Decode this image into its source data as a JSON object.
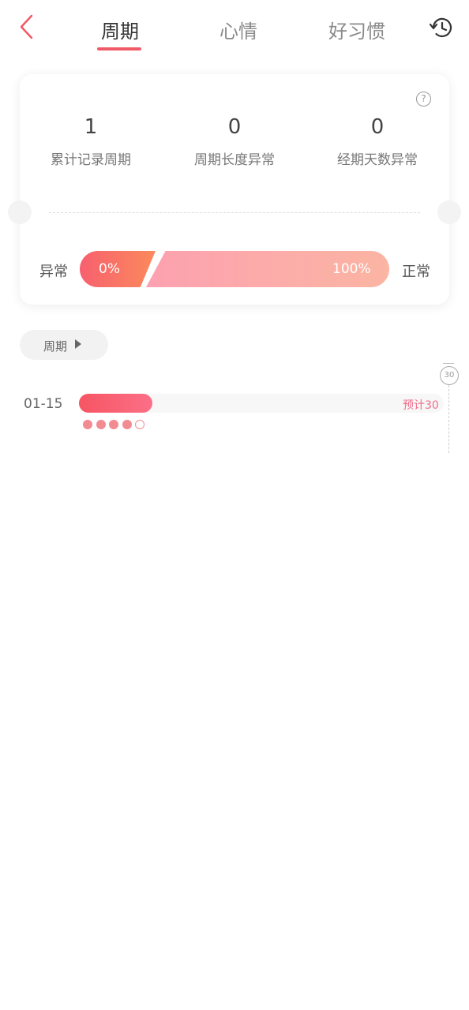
{
  "tabs": [
    {
      "label": "周期",
      "active": true
    },
    {
      "label": "心情",
      "active": false
    },
    {
      "label": "好习惯",
      "active": false
    }
  ],
  "icons": {
    "back": "chevron-left-icon",
    "history": "history-icon",
    "help": "question-circle-icon"
  },
  "colors": {
    "accent": "#f05a66",
    "abnormal_gradient": [
      "#f7606f",
      "#fb8a5c"
    ],
    "normal_gradient": [
      "#fca1b0",
      "#fbb5a3"
    ]
  },
  "stats": [
    {
      "value": "1",
      "label": "累计记录周期"
    },
    {
      "value": "0",
      "label": "周期长度异常"
    },
    {
      "value": "0",
      "label": "经期天数异常"
    }
  ],
  "ratio": {
    "abnormal_label": "异常",
    "normal_label": "正常",
    "abnormal_percent": "0%",
    "normal_percent": "100%"
  },
  "help_symbol": "?",
  "cycle_filter": {
    "label": "周期"
  },
  "timeline": {
    "marker_value": "30",
    "rows": [
      {
        "date": "01-15",
        "estimate": "预计30",
        "period_days_filled": 4,
        "period_days_total": 5
      }
    ]
  }
}
